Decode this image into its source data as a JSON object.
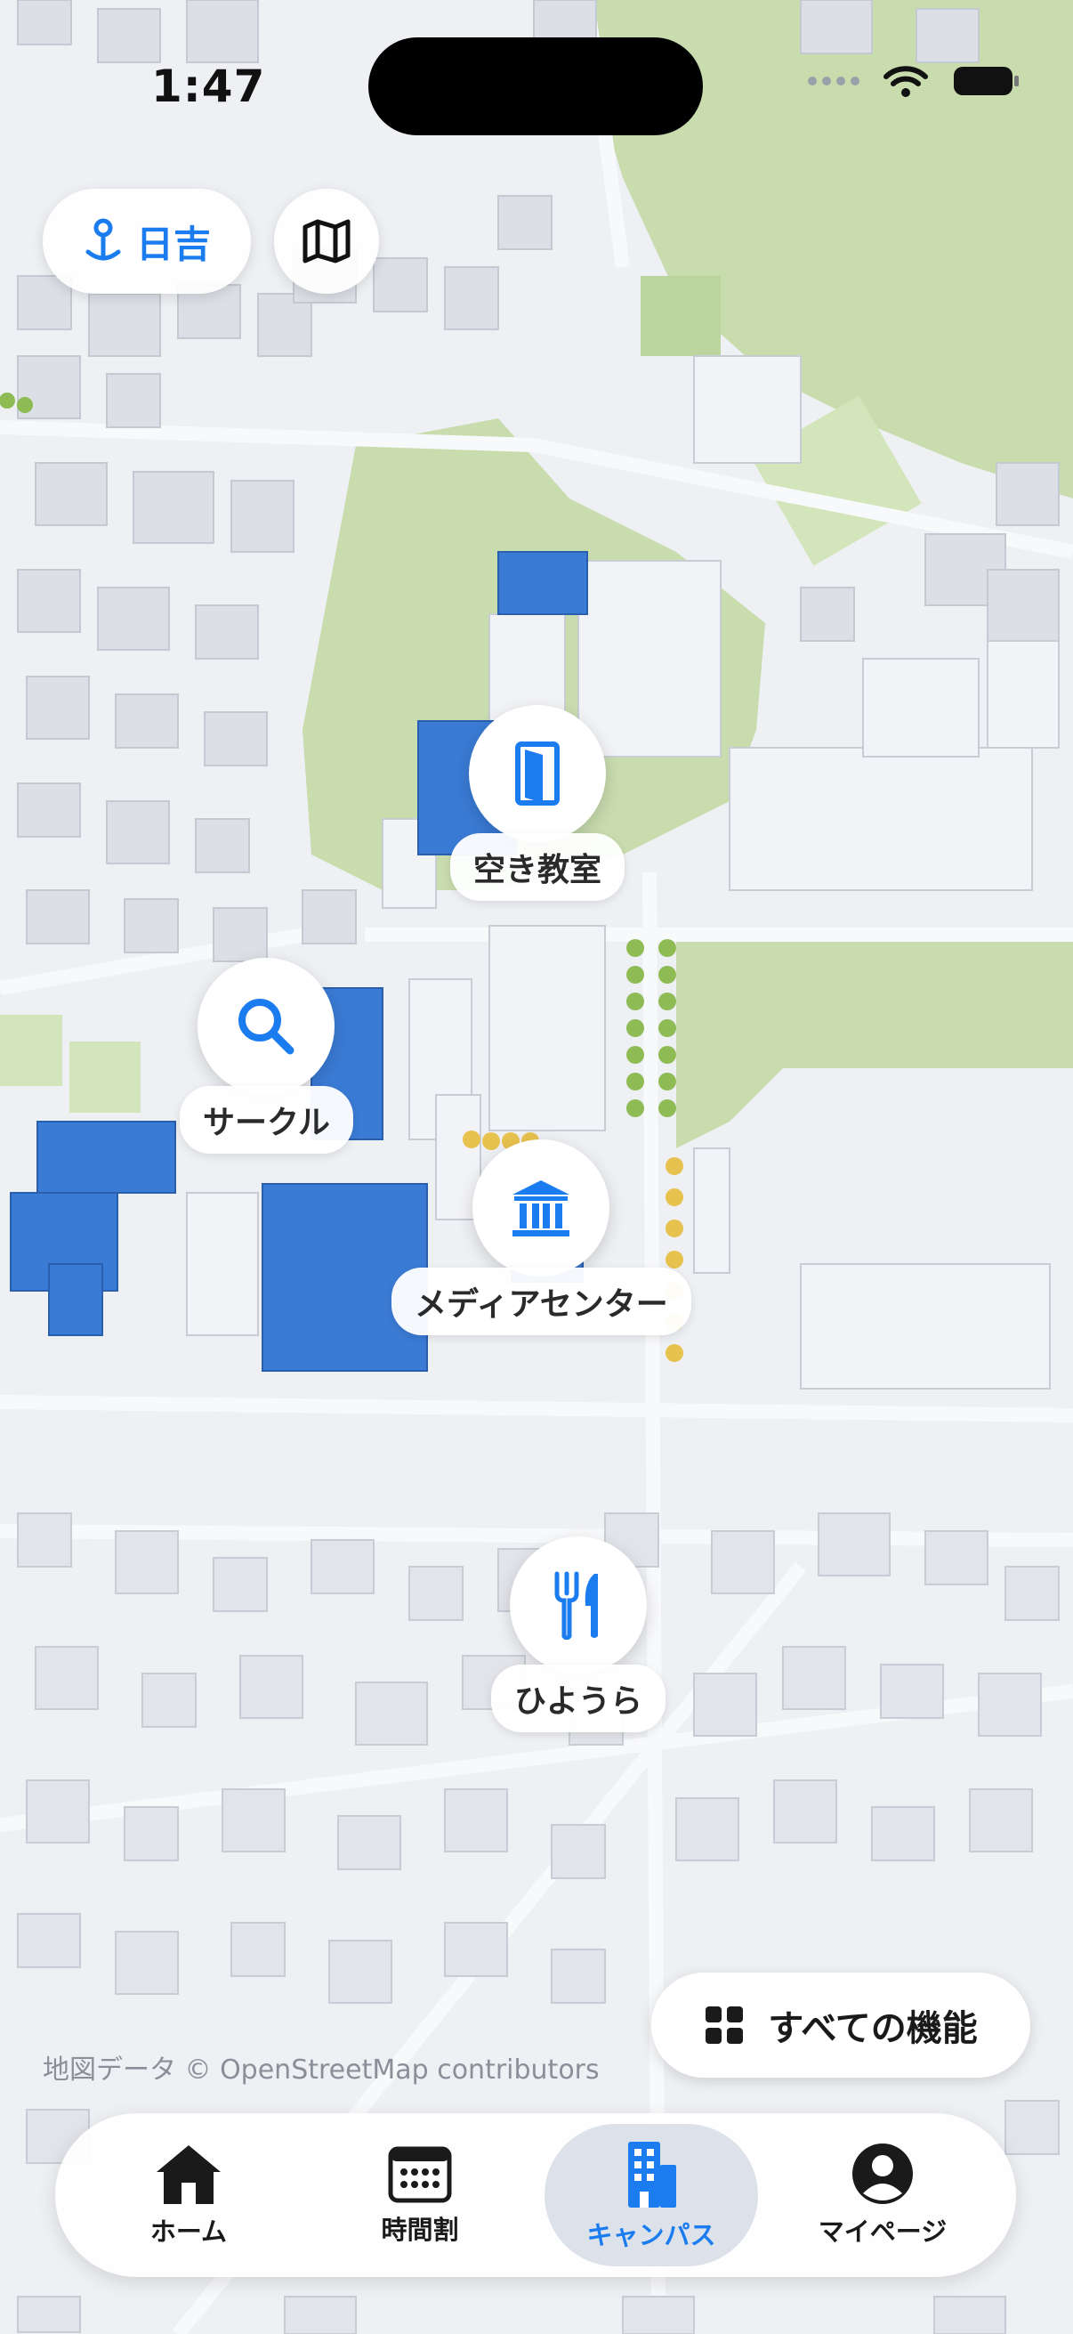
{
  "status_bar": {
    "time": "1:47"
  },
  "top_controls": {
    "campus_label": "日吉"
  },
  "markers": [
    {
      "label": "空き教室",
      "icon": "door-icon"
    },
    {
      "label": "サークル",
      "icon": "search-icon"
    },
    {
      "label": "メディアセンター",
      "icon": "library-icon"
    },
    {
      "label": "ひようら",
      "icon": "fork-knife-icon"
    }
  ],
  "attribution": "地図データ © OpenStreetMap contributors",
  "all_features_label": "すべての機能",
  "tabbar": {
    "items": [
      {
        "label": "ホーム",
        "icon": "house-icon",
        "active": false
      },
      {
        "label": "時間割",
        "icon": "calendar-icon",
        "active": false
      },
      {
        "label": "キャンパス",
        "icon": "building-icon",
        "active": true
      },
      {
        "label": "マイページ",
        "icon": "person-icon",
        "active": false
      }
    ]
  },
  "colors": {
    "accent": "#1b7cf0",
    "highlight_building": "#3a7bd5",
    "park": "#c8dcae"
  }
}
